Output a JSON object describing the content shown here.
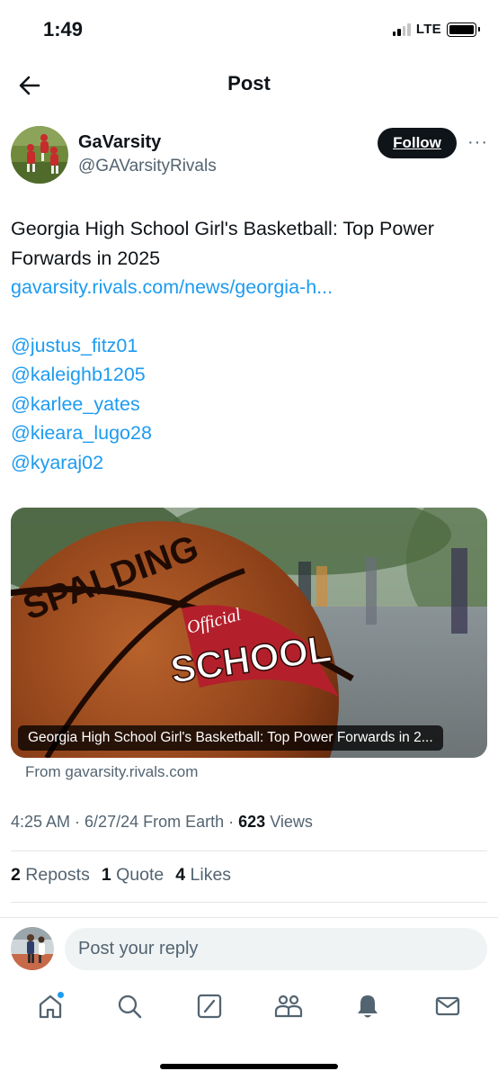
{
  "status_bar": {
    "time": "1:49",
    "network": "LTE"
  },
  "header": {
    "title": "Post"
  },
  "author": {
    "name": "GaVarsity",
    "handle": "@GAVarsityRivals",
    "follow_label": "Follow"
  },
  "tweet": {
    "text": "Georgia High School Girl's Basketball: Top Power Forwards in 2025",
    "link": "gavarsity.rivals.com/news/georgia-h...",
    "mentions": [
      "@justus_fitz01",
      "@kaleighb1205",
      "@karlee_yates",
      "@kieara_lugo28",
      "@kyaraj02"
    ]
  },
  "card": {
    "caption": "Georgia High School Girl's Basketball: Top Power Forwards in 2...",
    "source": "From gavarsity.rivals.com",
    "image_lettering": [
      "SPALDING",
      "Official",
      "SCHOOL"
    ]
  },
  "meta": {
    "time": "4:25 AM",
    "date": "6/27/24",
    "location": "From Earth",
    "views_count": "623",
    "views_label": "Views"
  },
  "stats": {
    "reposts_count": "2",
    "reposts_label": "Reposts",
    "quotes_count": "1",
    "quotes_label": "Quote",
    "likes_count": "4",
    "likes_label": "Likes"
  },
  "reply": {
    "placeholder": "Post your reply"
  },
  "tabbar": {
    "icons": [
      "home-icon",
      "search-icon",
      "compose-icon",
      "communities-icon",
      "notifications-icon",
      "messages-icon"
    ]
  },
  "colors": {
    "accent": "#1d9bf0",
    "text": "#0f1419",
    "secondary": "#536471",
    "divider": "#e1e6ea"
  }
}
